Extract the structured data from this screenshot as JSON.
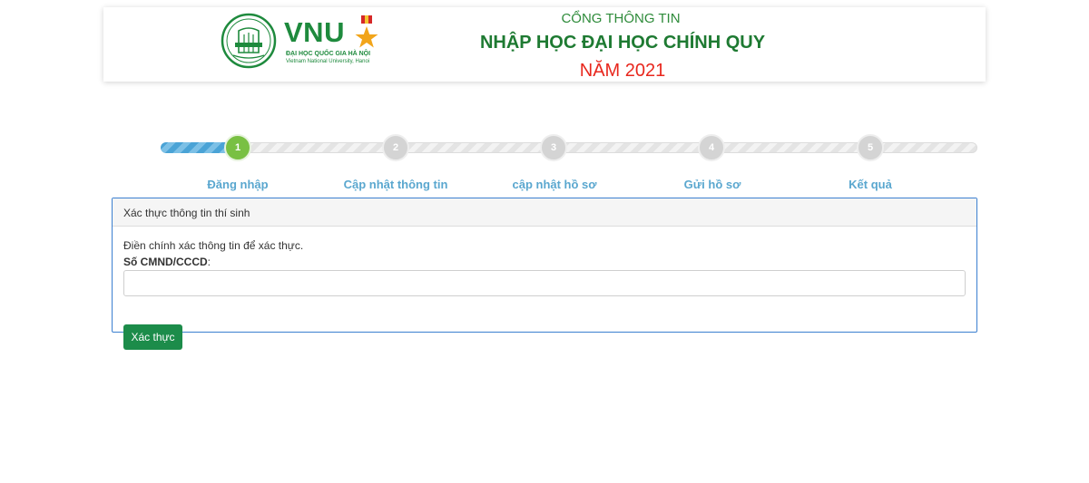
{
  "header": {
    "logo": {
      "brand": "VNU",
      "seal_text": "ĐHQGHN",
      "line1": "ĐẠI HỌC QUỐC GIA HÀ NỘI",
      "line2": "Vietnam National University, Hanoi",
      "brand_color": "#1e8a3d"
    },
    "portal_title": "CỔNG THÔNG TIN",
    "main_title": "NHẬP HỌC ĐẠI HỌC CHÍNH QUY",
    "year_title": "NĂM 2021",
    "year_color": "#e8271d"
  },
  "steps": {
    "current": 1,
    "progress_fraction": 0.094,
    "items": [
      {
        "number": "1",
        "label": "Đăng nhập",
        "active": true
      },
      {
        "number": "2",
        "label": "Cập nhật thông tin",
        "active": false
      },
      {
        "number": "3",
        "label": "cập nhật hồ sơ",
        "active": false
      },
      {
        "number": "4",
        "label": "Gửi hồ sơ",
        "active": false
      },
      {
        "number": "5",
        "label": "Kết quả",
        "active": false
      }
    ],
    "active_color": "#79c043",
    "inactive_color": "#d4d4d4",
    "label_color": "#5aa7cf"
  },
  "panel": {
    "heading": "Xác thực thông tin thí sinh",
    "instruction": "Điền chính xác thông tin để xác thực.",
    "field_label": "Số CMND/CCCD",
    "field_suffix": ":",
    "input_value": "",
    "input_placeholder": "",
    "submit_label": "Xác thực",
    "submit_color": "#1c8c4a",
    "border_color": "#3b7fd0"
  }
}
